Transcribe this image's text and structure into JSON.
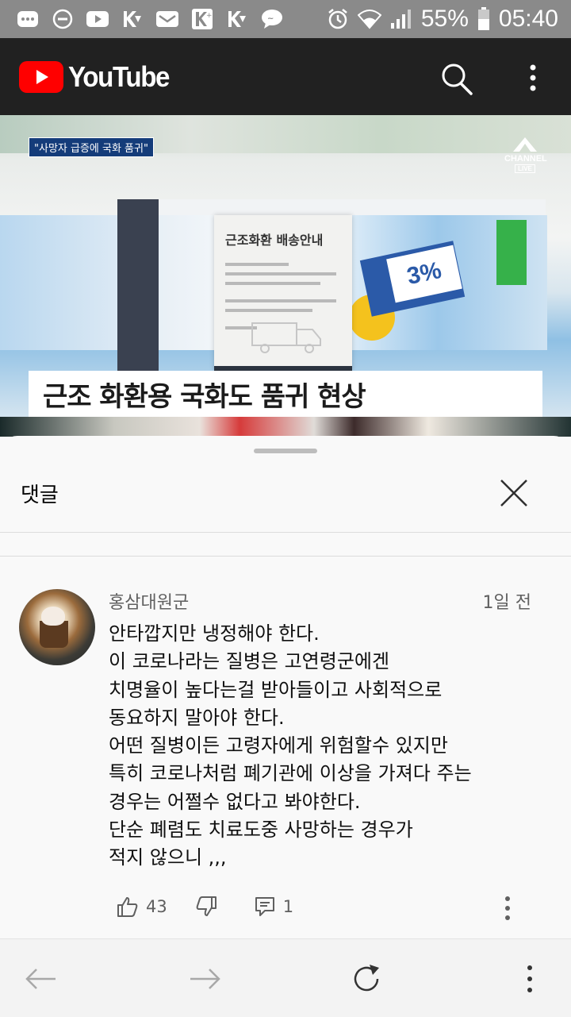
{
  "status_bar": {
    "battery": "55%",
    "time": "05:40",
    "icons": [
      "more-horiz-icon",
      "do-not-disturb-icon",
      "youtube-icon",
      "k-app-icon",
      "mail-app-icon",
      "k-plus-icon",
      "k-app-icon",
      "chat-bubble-icon",
      "alarm-icon",
      "wifi-icon",
      "signal-icon",
      "battery-icon"
    ]
  },
  "header": {
    "logo_text": "YouTube",
    "search_icon": "search-icon",
    "more_icon": "more-vert-icon"
  },
  "video": {
    "news_tag": "\"사망자 급증에 국화 품귀\"",
    "channel_logo": "CHANNEL",
    "channel_live": "LIVE",
    "popup_title": "근조화환 배송안내",
    "coupon_text": "3%",
    "caption": "근조 화환용 국화도 품귀 현상"
  },
  "comments_sheet": {
    "title": "댓글",
    "close_icon": "close-icon"
  },
  "comment": {
    "author": "홍삼대원군",
    "time": "1일 전",
    "text": "안타깝지만 냉정해야 한다.\n이 코로나라는 질병은 고연령군에겐\n치명율이 높다는걸 받아들이고 사회적으로\n동요하지 말아야 한다.\n어떤 질병이든 고령자에게 위험할수 있지만\n특히 코로나처럼 폐기관에 이상을 가져다 주는\n경우는 어쩔수 없다고 봐야한다.\n단순 폐렴도 치료도중 사망하는 경우가\n적지 않으니 ,,,",
    "likes": "43",
    "replies": "1"
  },
  "bottom_bar": {
    "back_icon": "arrow-back-icon",
    "forward_icon": "arrow-forward-icon",
    "refresh_icon": "refresh-icon",
    "more_icon": "more-vert-icon"
  },
  "colors": {
    "youtube_red": "#ff0000",
    "header_bg": "#212121",
    "status_bg": "#8a8a8a",
    "sheet_bg": "#f9f9f9",
    "caption_blue": "#143c7a"
  }
}
